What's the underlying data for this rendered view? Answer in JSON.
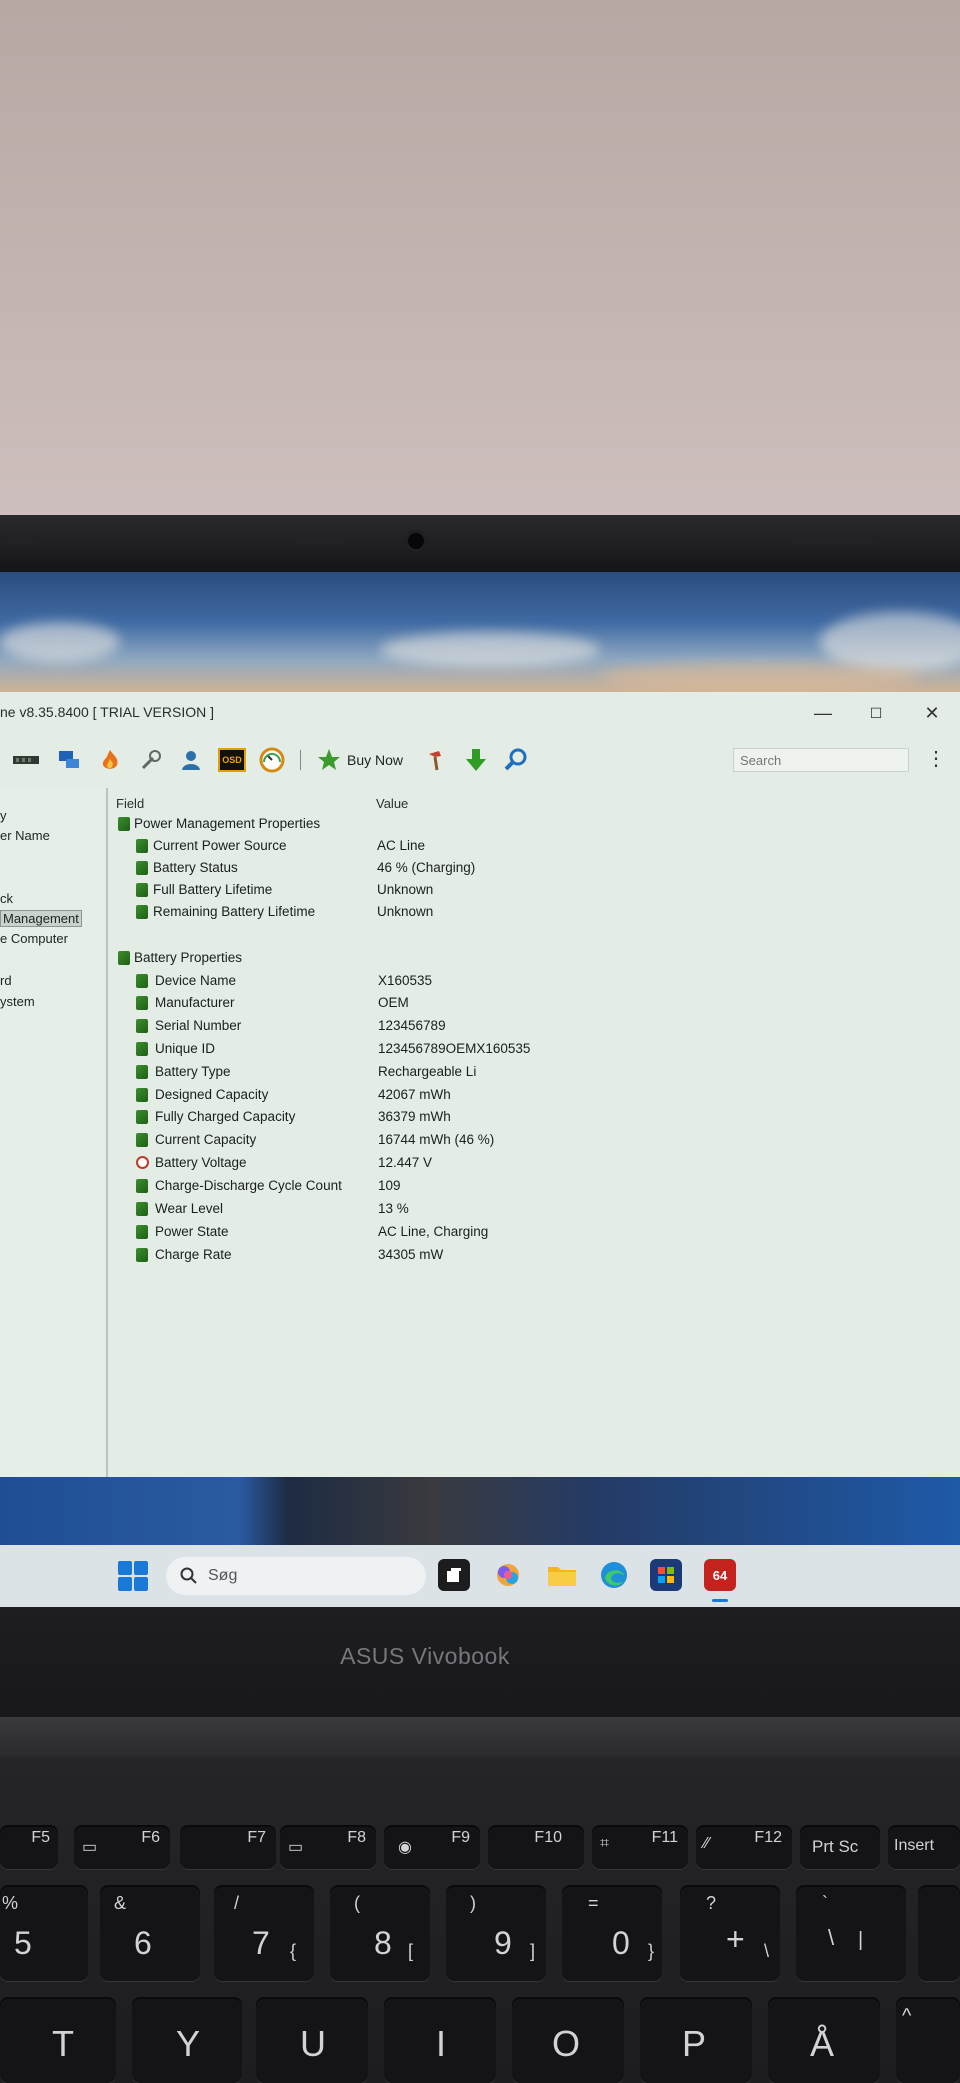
{
  "window": {
    "title": "ne v8.35.8400  [ TRIAL VERSION ]",
    "minimize_glyph": "—",
    "maximize_glyph": "☐",
    "close_glyph": "✕"
  },
  "toolbar": {
    "buy_now_label": "Buy Now",
    "osd_label": "OSD",
    "search_placeholder": "Search"
  },
  "sidebar": {
    "items": [
      "y",
      "er Name",
      "ck",
      "Management",
      "e Computer",
      "rd",
      "ystem"
    ],
    "selected": "Management"
  },
  "table": {
    "columns": [
      "Field",
      "Value"
    ],
    "groups": [
      {
        "name": "Power Management Properties",
        "rows": [
          {
            "field": "Current Power Source",
            "value": "AC Line",
            "icon": "leaf-icon"
          },
          {
            "field": "Battery Status",
            "value": "46 % (Charging)",
            "icon": "leaf-icon"
          },
          {
            "field": "Full Battery Lifetime",
            "value": "Unknown",
            "icon": "leaf-icon"
          },
          {
            "field": "Remaining Battery Lifetime",
            "value": "Unknown",
            "icon": "leaf-icon"
          }
        ]
      },
      {
        "name": "Battery Properties",
        "rows": [
          {
            "field": "Device Name",
            "value": "X160535",
            "icon": "leaf-icon"
          },
          {
            "field": "Manufacturer",
            "value": "OEM",
            "icon": "leaf-icon"
          },
          {
            "field": "Serial Number",
            "value": "123456789",
            "icon": "leaf-icon"
          },
          {
            "field": "Unique ID",
            "value": "123456789OEMX160535",
            "icon": "leaf-icon"
          },
          {
            "field": "Battery Type",
            "value": "Rechargeable Li",
            "icon": "leaf-icon"
          },
          {
            "field": "Designed Capacity",
            "value": "42067 mWh",
            "icon": "leaf-icon"
          },
          {
            "field": "Fully Charged Capacity",
            "value": "36379 mWh",
            "icon": "leaf-icon"
          },
          {
            "field": "Current Capacity",
            "value": "16744 mWh  (46 %)",
            "icon": "leaf-icon"
          },
          {
            "field": "Battery Voltage",
            "value": "12.447 V",
            "icon": "voltage-icon"
          },
          {
            "field": "Charge-Discharge Cycle Count",
            "value": "109",
            "icon": "leaf-icon"
          },
          {
            "field": "Wear Level",
            "value": "13 %",
            "icon": "leaf-icon"
          },
          {
            "field": "Power State",
            "value": "AC Line, Charging",
            "icon": "leaf-icon"
          },
          {
            "field": "Charge Rate",
            "value": "34305 mW",
            "icon": "leaf-icon"
          }
        ]
      }
    ]
  },
  "taskbar": {
    "search_label": "Søg",
    "aida_label": "64"
  },
  "laptop": {
    "brand": "ASUS Vivobook"
  },
  "keyboard": {
    "fn_row": [
      "F5",
      "F6",
      "F7",
      "F8",
      "F9",
      "F10",
      "F11",
      "F12",
      "Prt Sc",
      "Insert"
    ],
    "num_row": [
      {
        "main": "5",
        "shift": "%"
      },
      {
        "main": "6",
        "shift": "&"
      },
      {
        "main": "7",
        "shift": "/",
        "alt": "{"
      },
      {
        "main": "8",
        "shift": "(",
        "alt": "["
      },
      {
        "main": "9",
        "shift": ")",
        "alt": "]"
      },
      {
        "main": "0",
        "shift": "=",
        "alt": "}"
      },
      {
        "main": "+",
        "shift": "?",
        "alt": "\\"
      },
      {
        "main": "\\",
        "shift": "`",
        "alt": "|"
      }
    ],
    "letter_row": [
      "T",
      "Y",
      "U",
      "I",
      "O",
      "P",
      "Å",
      "^"
    ]
  }
}
